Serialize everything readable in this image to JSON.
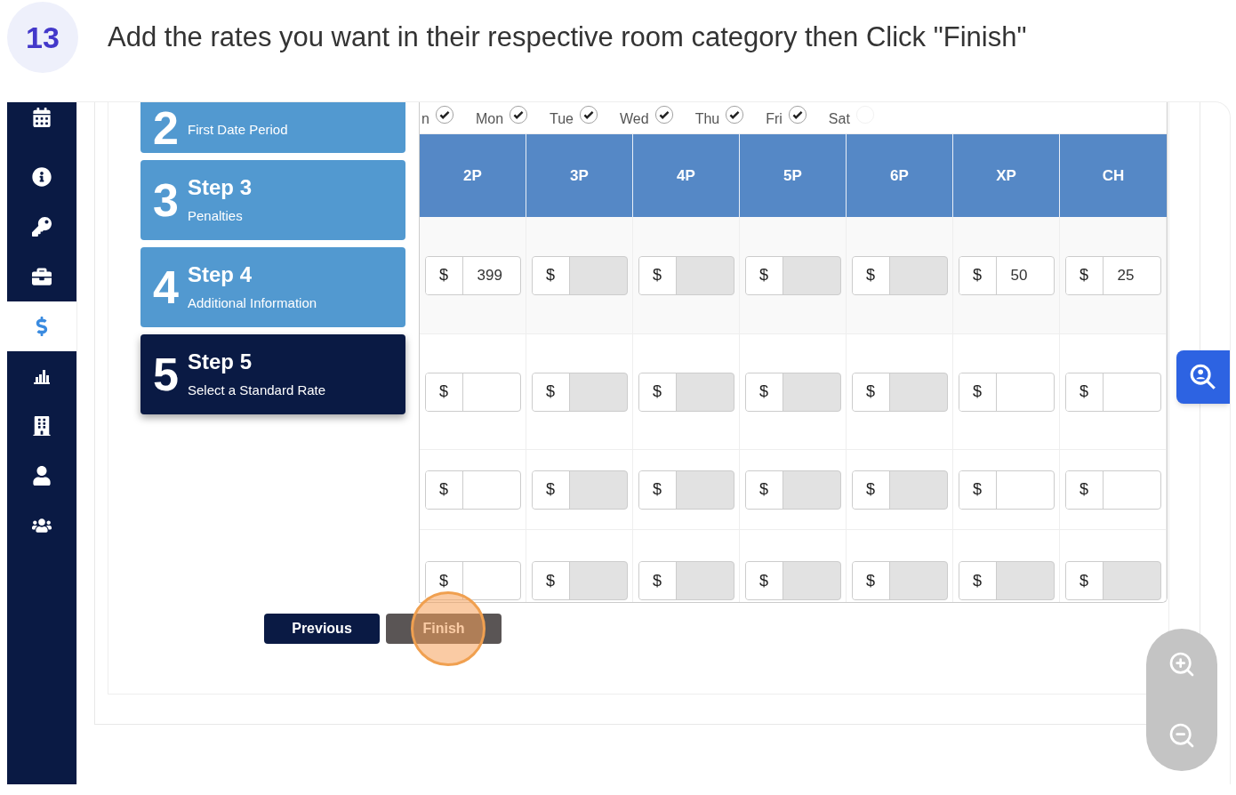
{
  "step_badge": "13",
  "instruction": "Add the rates you want in their respective room category then Click \"Finish\"",
  "sidebar": {
    "items": [
      {
        "selected": false
      },
      {
        "selected": false
      },
      {
        "selected": false
      },
      {
        "selected": false
      },
      {
        "selected": true
      },
      {
        "selected": false
      },
      {
        "selected": false
      },
      {
        "selected": false
      },
      {
        "selected": false
      }
    ]
  },
  "steps": [
    {
      "number": "2",
      "subtitle": "First Date Period",
      "selected": false
    },
    {
      "number": "3",
      "title": "Step 3",
      "subtitle": "Penalties",
      "selected": false
    },
    {
      "number": "4",
      "title": "Step 4",
      "subtitle": "Additional Information",
      "selected": false
    },
    {
      "number": "5",
      "title": "Step 5",
      "subtitle": "Select a Standard Rate",
      "selected": true
    }
  ],
  "days": [
    {
      "label": "n",
      "checked": true
    },
    {
      "label": "Mon",
      "checked": true
    },
    {
      "label": "Tue",
      "checked": true
    },
    {
      "label": "Wed",
      "checked": true
    },
    {
      "label": "Thu",
      "checked": true
    },
    {
      "label": "Fri",
      "checked": true
    },
    {
      "label": "Sat",
      "checked": false
    }
  ],
  "table": {
    "columns": [
      "2P",
      "3P",
      "4P",
      "5P",
      "6P",
      "XP",
      "CH"
    ],
    "rows": [
      {
        "cells": [
          {
            "prefix": "$",
            "value": "399",
            "disabled": false
          },
          {
            "prefix": "$",
            "disabled": true
          },
          {
            "prefix": "$",
            "disabled": true
          },
          {
            "prefix": "$",
            "disabled": true
          },
          {
            "prefix": "$",
            "disabled": true
          },
          {
            "prefix": "$",
            "value": "50",
            "disabled": false
          },
          {
            "prefix": "$",
            "value": "25",
            "disabled": false
          }
        ]
      },
      {
        "cells": [
          {
            "prefix": "$",
            "disabled": false
          },
          {
            "prefix": "$",
            "disabled": true
          },
          {
            "prefix": "$",
            "disabled": true
          },
          {
            "prefix": "$",
            "disabled": true
          },
          {
            "prefix": "$",
            "disabled": true
          },
          {
            "prefix": "$",
            "disabled": false
          },
          {
            "prefix": "$",
            "disabled": false
          }
        ]
      },
      {
        "cells": [
          {
            "prefix": "$",
            "disabled": false
          },
          {
            "prefix": "$",
            "disabled": true
          },
          {
            "prefix": "$",
            "disabled": true
          },
          {
            "prefix": "$",
            "disabled": true
          },
          {
            "prefix": "$",
            "disabled": true
          },
          {
            "prefix": "$",
            "disabled": false
          },
          {
            "prefix": "$",
            "disabled": false
          }
        ]
      },
      {
        "cells": [
          {
            "prefix": "$",
            "disabled": false
          },
          {
            "prefix": "$",
            "disabled": true
          },
          {
            "prefix": "$",
            "disabled": true
          },
          {
            "prefix": "$",
            "disabled": true
          },
          {
            "prefix": "$",
            "disabled": true
          },
          {
            "prefix": "$",
            "disabled": true
          },
          {
            "prefix": "$",
            "disabled": true
          }
        ]
      }
    ]
  },
  "buttons": [
    {
      "label": "Previous",
      "kind": "primary"
    },
    {
      "label": "Finish",
      "kind": "secondary"
    }
  ]
}
